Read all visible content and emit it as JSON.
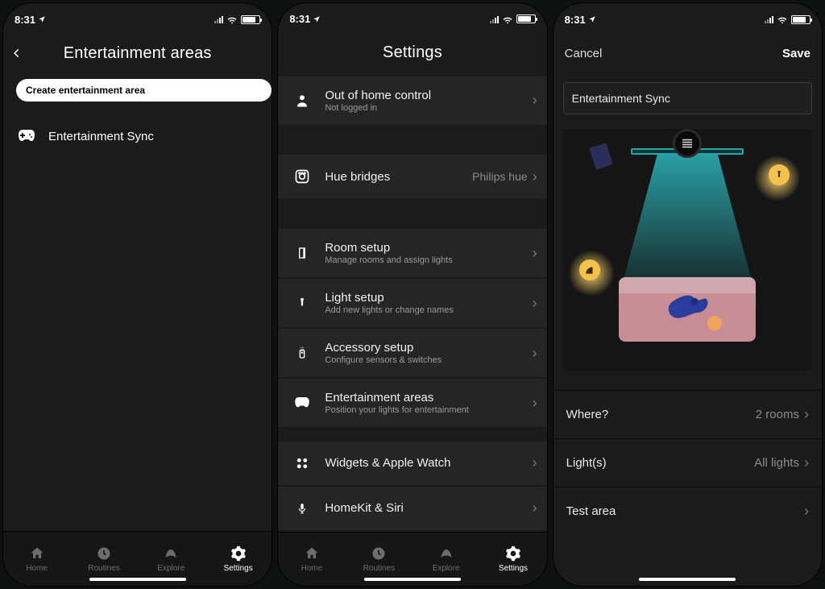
{
  "status": {
    "time": "8:31"
  },
  "screen1": {
    "title": "Entertainment areas",
    "create_button": "Create entertainment area",
    "items": [
      {
        "label": "Entertainment Sync"
      }
    ],
    "tabs": {
      "home": "Home",
      "routines": "Routines",
      "explore": "Explore",
      "settings": "Settings"
    }
  },
  "screen2": {
    "title": "Settings",
    "items": [
      {
        "label": "Out of home control",
        "sub": "Not logged in"
      },
      {
        "label": "Hue bridges",
        "value": "Philips hue"
      },
      {
        "label": "Room setup",
        "sub": "Manage rooms and assign lights"
      },
      {
        "label": "Light setup",
        "sub": "Add new lights or change names"
      },
      {
        "label": "Accessory setup",
        "sub": "Configure sensors & switches"
      },
      {
        "label": "Entertainment areas",
        "sub": "Position your lights for entertainment"
      },
      {
        "label": "Widgets & Apple Watch"
      },
      {
        "label": "HomeKit & Siri"
      }
    ],
    "tabs": {
      "home": "Home",
      "routines": "Routines",
      "explore": "Explore",
      "settings": "Settings"
    }
  },
  "screen3": {
    "cancel": "Cancel",
    "save": "Save",
    "name_value": "Entertainment Sync",
    "options": [
      {
        "label": "Where?",
        "value": "2 rooms"
      },
      {
        "label": "Light(s)",
        "value": "All lights"
      },
      {
        "label": "Test area",
        "value": ""
      }
    ]
  }
}
